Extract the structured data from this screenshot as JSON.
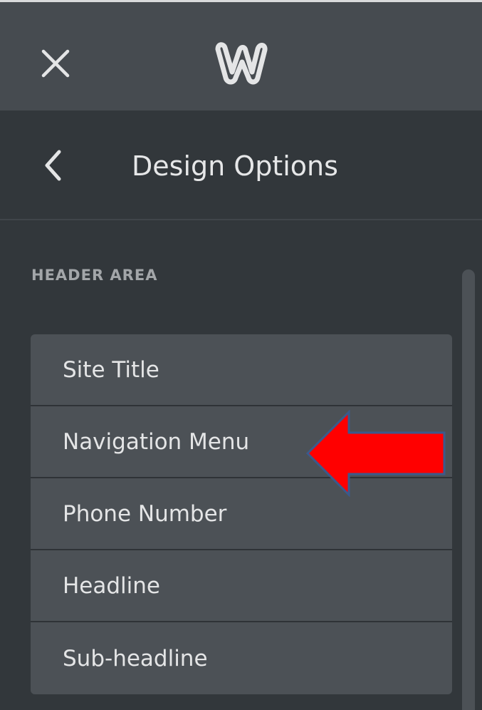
{
  "topbar": {
    "close_icon": "close-icon",
    "logo_icon": "weebly-logo-icon",
    "logo_letter": "W"
  },
  "panel": {
    "back_icon": "chevron-left-icon",
    "title": "Design Options"
  },
  "section": {
    "label": "HEADER AREA",
    "items": [
      {
        "label": "Site Title"
      },
      {
        "label": "Navigation Menu"
      },
      {
        "label": "Phone Number"
      },
      {
        "label": "Headline"
      },
      {
        "label": "Sub-headline"
      }
    ]
  },
  "annotation": {
    "arrow_icon": "red-arrow-left-icon",
    "arrow_color": "#ff0000",
    "arrow_outline": "#3b5a8c"
  },
  "colors": {
    "topbar_bg": "#464b50",
    "panel_bg": "#32373b",
    "item_bg": "#4c5156",
    "text": "#e4e5e6"
  }
}
